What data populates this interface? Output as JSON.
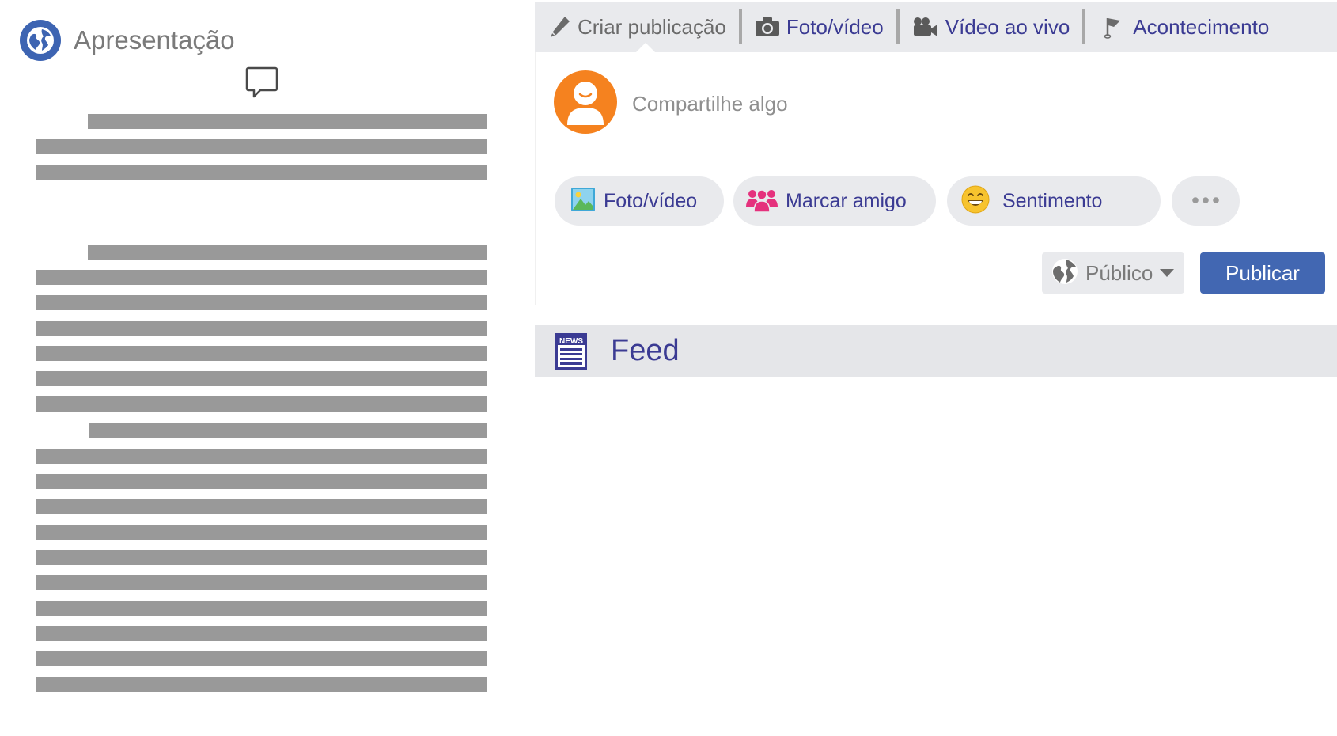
{
  "presentation": {
    "title": "Apresentação",
    "globe_icon": "globe-icon",
    "comment_icon": "speech-bubble-icon",
    "text_placeholder_color": "#999999"
  },
  "composer": {
    "tabs": [
      {
        "label": "Criar publicação",
        "icon": "pencil-icon"
      },
      {
        "label": "Foto/vídeo",
        "icon": "camera-icon"
      },
      {
        "label": "Vídeo ao vivo",
        "icon": "video-camera-icon"
      },
      {
        "label": "Acontecimento",
        "icon": "flag-icon"
      }
    ],
    "share_placeholder": "Compartilhe algo",
    "avatar_color": "#f5821f",
    "actions": [
      {
        "label": "Foto/vídeo",
        "icon": "photo-icon"
      },
      {
        "label": "Marcar amigo",
        "icon": "friends-icon"
      },
      {
        "label": "Sentimento",
        "icon": "smiley-icon"
      },
      {
        "label": "",
        "icon": "more-dots-icon"
      }
    ],
    "audience": "Público",
    "publish": "Publicar",
    "accent": "#4267b2",
    "link_color": "#3b3b93"
  },
  "feed": {
    "title": "Feed",
    "icon": "news-icon",
    "icon_text": "NEWS"
  }
}
